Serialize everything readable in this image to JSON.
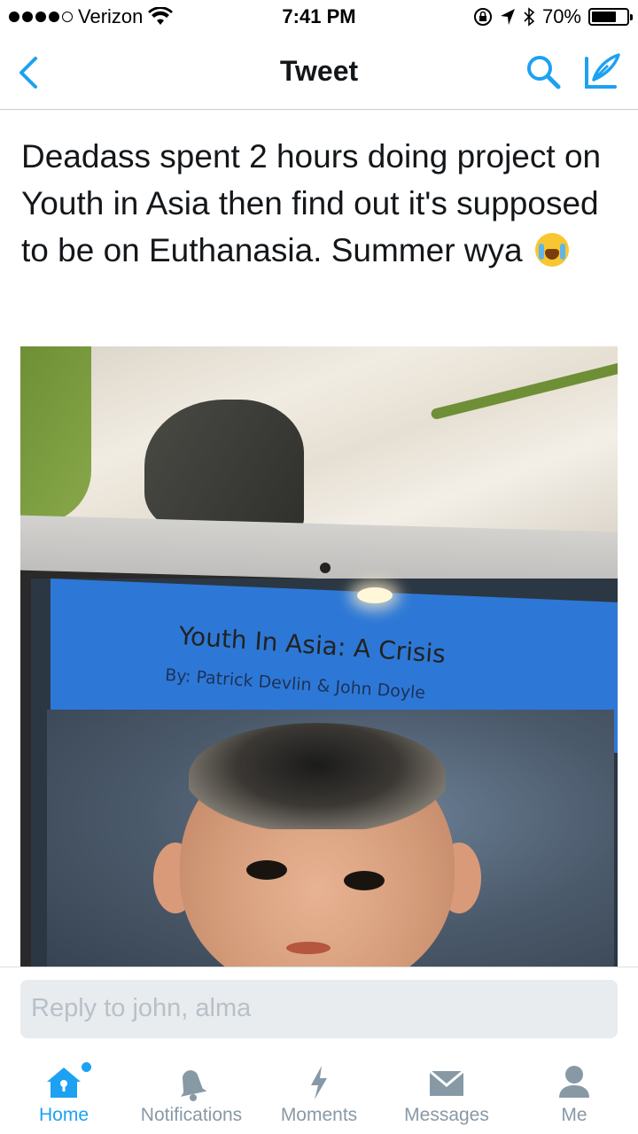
{
  "status_bar": {
    "carrier": "Verizon",
    "time": "7:41 PM",
    "battery": "70%",
    "battery_level": 0.7
  },
  "nav": {
    "title": "Tweet",
    "back_icon": "chevron-left-icon",
    "search_icon": "search-icon",
    "compose_icon": "compose-icon"
  },
  "tweet": {
    "text": "Deadass spent 2 hours doing project on Youth in Asia then find out it's supposed to be on Euthanasia. Summer wya",
    "emoji": "loudly-crying-face-emoji",
    "image": {
      "slide_title": "Youth In Asia: A Crisis",
      "slide_authors": "By: Patrick Devlin & John Doyle"
    }
  },
  "reply": {
    "placeholder": "Reply to john, alma"
  },
  "tabs": [
    {
      "label": "Home",
      "icon": "home-icon",
      "active": true
    },
    {
      "label": "Notifications",
      "icon": "bell-icon",
      "active": false
    },
    {
      "label": "Moments",
      "icon": "lightning-icon",
      "active": false
    },
    {
      "label": "Messages",
      "icon": "envelope-icon",
      "active": false
    },
    {
      "label": "Me",
      "icon": "person-icon",
      "active": false
    }
  ],
  "colors": {
    "accent": "#1da1f2",
    "inactive_tab": "#8899a6",
    "slide_header": "#2d78d6"
  }
}
